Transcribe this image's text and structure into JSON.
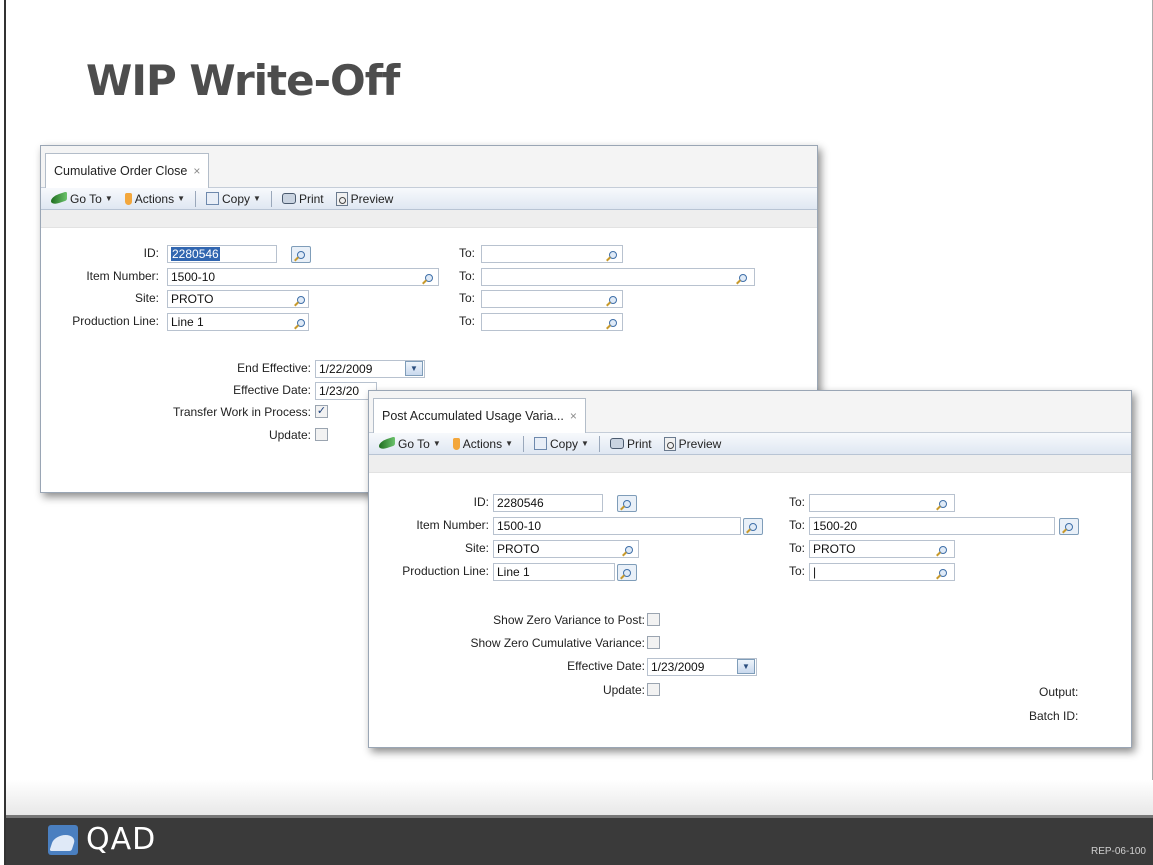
{
  "slide": {
    "title": "WIP Write-Off",
    "footer_brand": "QAD",
    "footer_code": "REP-06-100"
  },
  "toolbar": {
    "goto_label": "Go To",
    "actions_label": "Actions",
    "copy_label": "Copy",
    "print_label": "Print",
    "preview_label": "Preview"
  },
  "window1": {
    "tab_title": "Cumulative Order Close",
    "tab_close": "×",
    "fields": {
      "id_label": "ID:",
      "id_value": "2280546",
      "id_to_label": "To:",
      "id_to_value": "",
      "item_label": "Item Number:",
      "item_value": "1500-10",
      "item_to_label": "To:",
      "item_to_value": "",
      "site_label": "Site:",
      "site_value": "PROTO",
      "site_to_label": "To:",
      "site_to_value": "",
      "line_label": "Production Line:",
      "line_value": "Line 1",
      "line_to_label": "To:",
      "line_to_value": "",
      "end_effective_label": "End Effective:",
      "end_effective_value": "1/22/2009",
      "effective_date_label": "Effective Date:",
      "effective_date_value": "1/23/20",
      "transfer_wip_label": "Transfer Work in Process:",
      "transfer_wip_checked": true,
      "update_label": "Update:",
      "update_checked": false
    }
  },
  "window2": {
    "tab_title": "Post Accumulated Usage Varia...",
    "tab_close": "×",
    "fields": {
      "id_label": "ID:",
      "id_value": "2280546",
      "id_to_label": "To:",
      "id_to_value": "",
      "item_label": "Item Number:",
      "item_value": "1500-10",
      "item_to_label": "To:",
      "item_to_value": "1500-20",
      "site_label": "Site:",
      "site_value": "PROTO",
      "site_to_label": "To:",
      "site_to_value": "PROTO",
      "line_label": "Production Line:",
      "line_value": "Line 1",
      "line_to_label": "To:",
      "line_to_value": "|",
      "show_zero_post_label": "Show Zero Variance to Post:",
      "show_zero_cum_label": "Show Zero Cumulative Variance:",
      "effective_date_label": "Effective Date:",
      "effective_date_value": "1/23/2009",
      "update_label": "Update:",
      "output_label": "Output:",
      "batch_label": "Batch ID:"
    }
  },
  "colors": {
    "title_gray": "#4d4d4d",
    "footer_dark": "#3a3a3a",
    "selection_blue": "#3166b0"
  }
}
